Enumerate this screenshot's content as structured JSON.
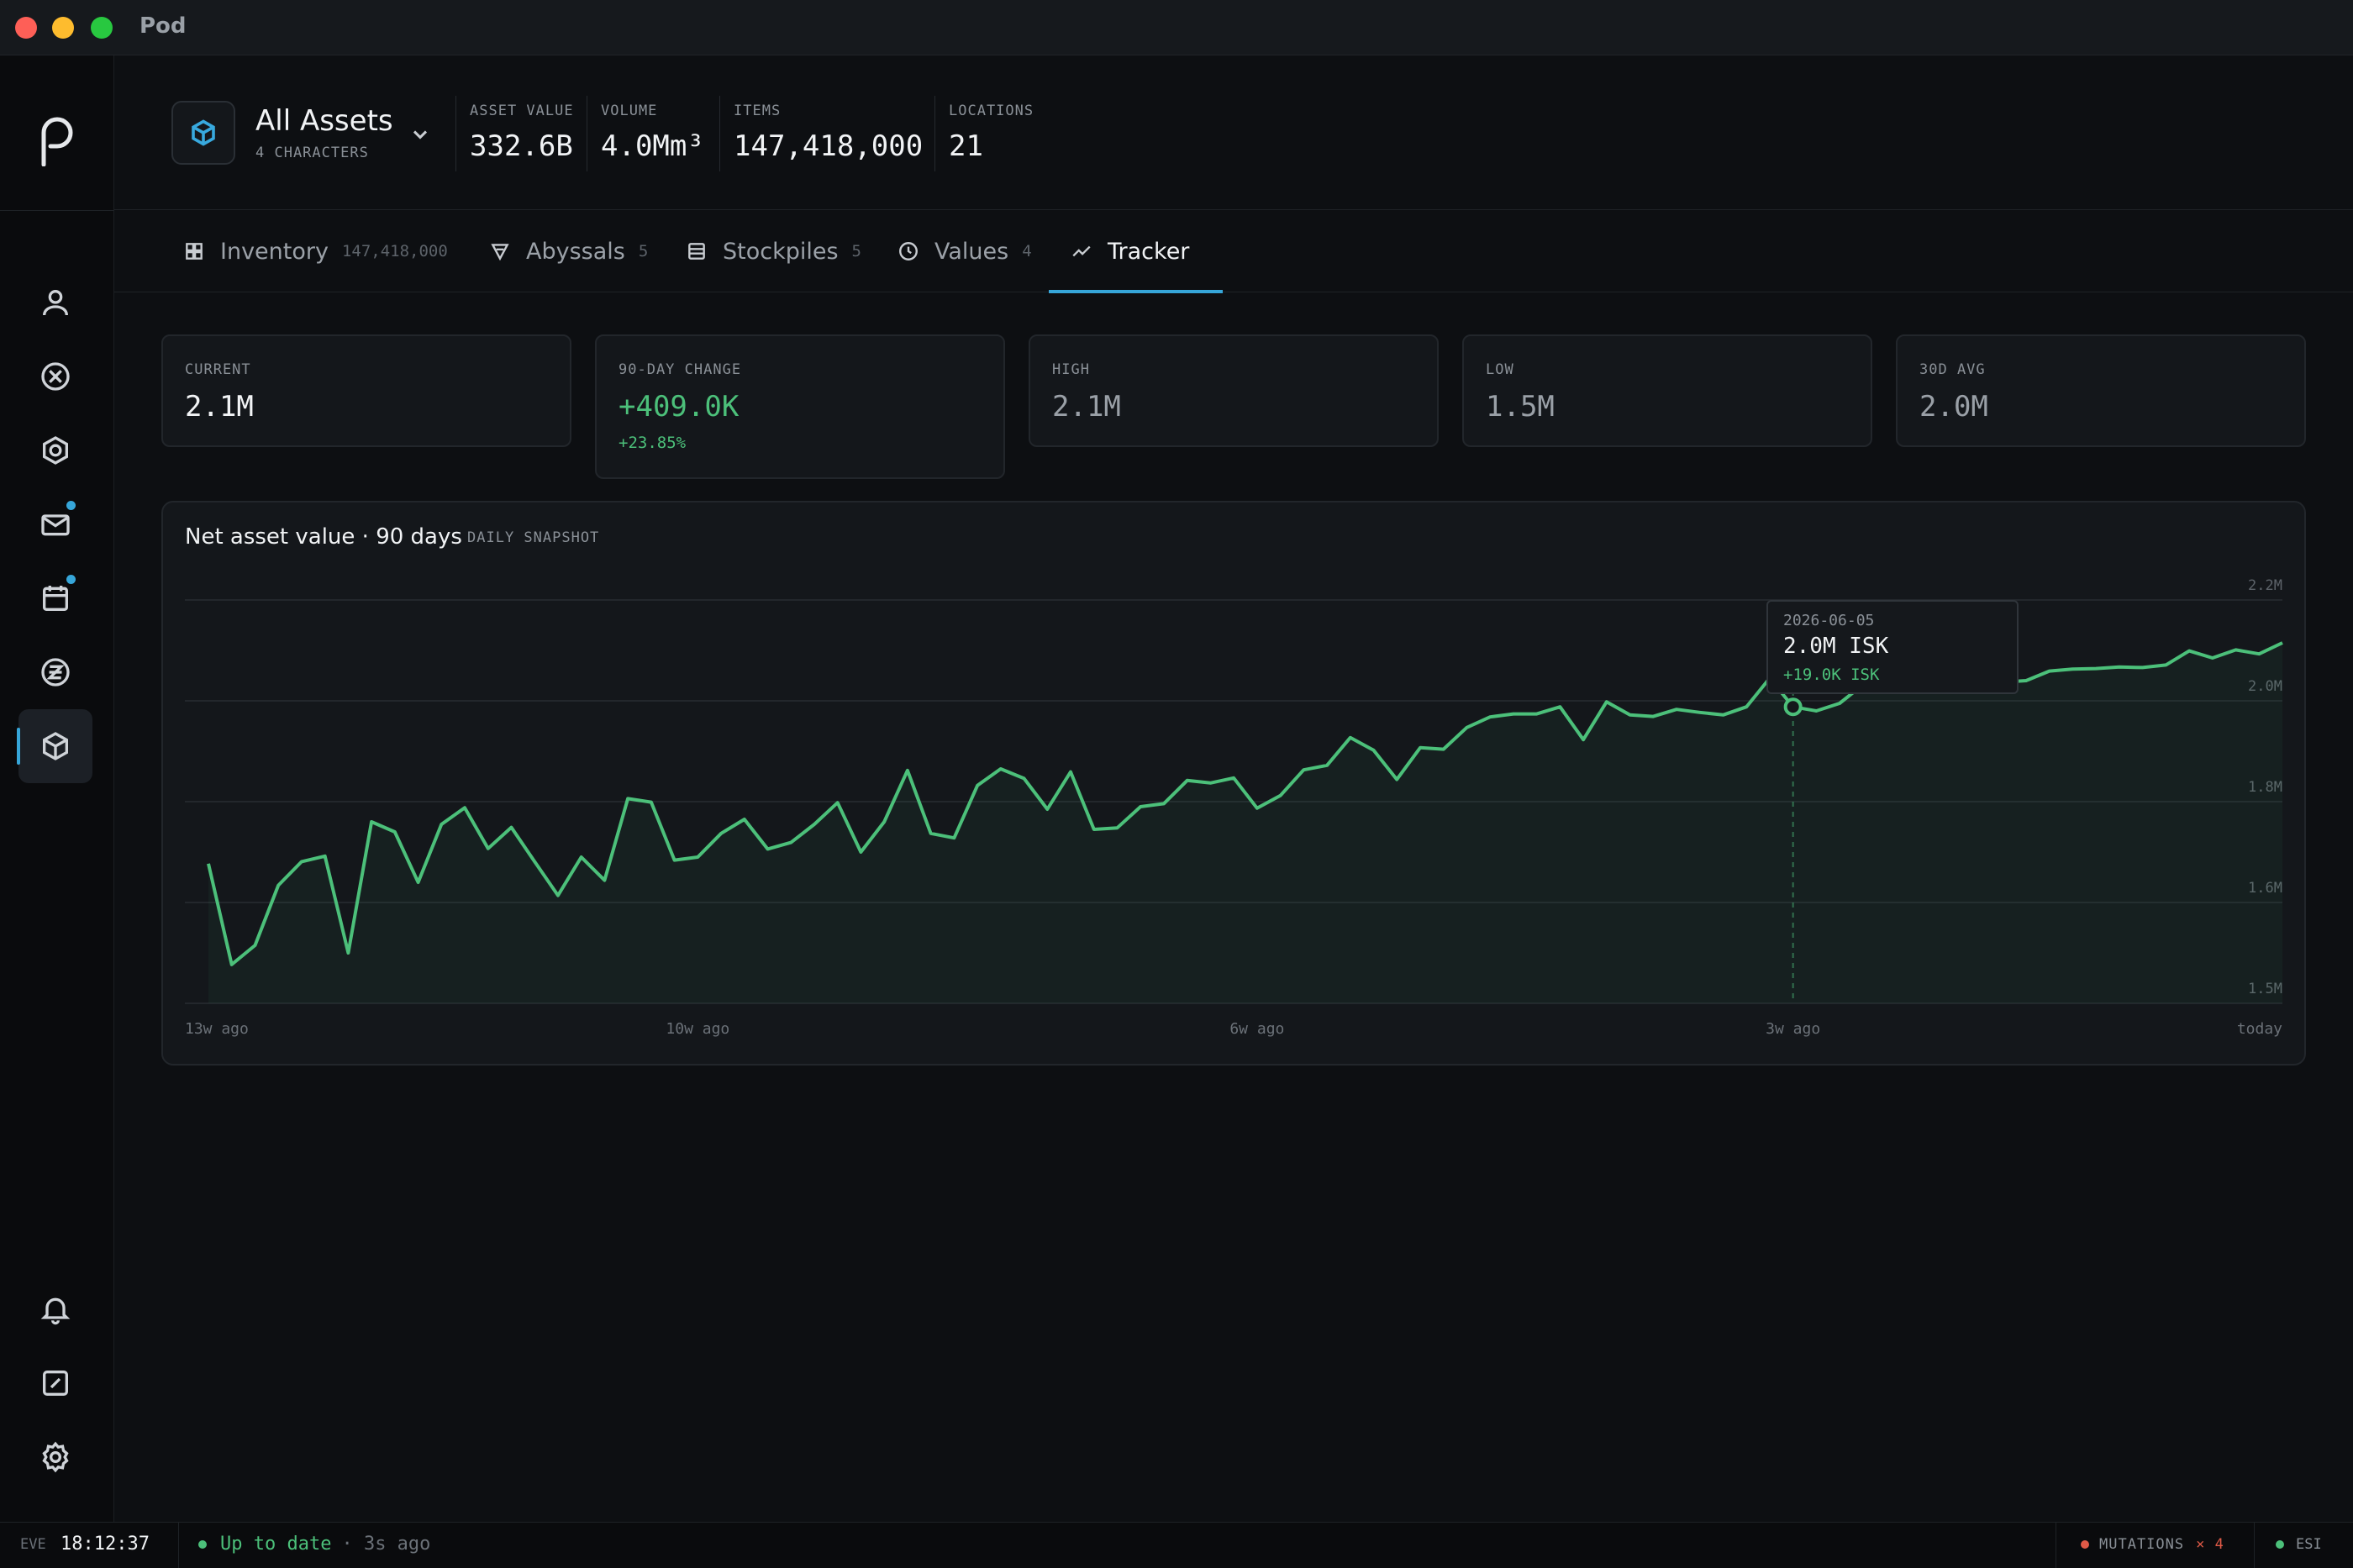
{
  "window": {
    "title": "Pod"
  },
  "header": {
    "title": "All Assets",
    "subtitle": "4 CHARACTERS",
    "stats": [
      {
        "label": "ASSET VALUE",
        "value": "332.6B"
      },
      {
        "label": "VOLUME",
        "value": "4.0Mm³"
      },
      {
        "label": "ITEMS",
        "value": "147,418,000"
      },
      {
        "label": "LOCATIONS",
        "value": "21"
      }
    ]
  },
  "tabs": [
    {
      "label": "Inventory",
      "count": "147,418,000",
      "icon": "grid-icon"
    },
    {
      "label": "Abyssals",
      "count": "5",
      "icon": "triangle-filter-icon"
    },
    {
      "label": "Stockpiles",
      "count": "5",
      "icon": "stack-icon"
    },
    {
      "label": "Values",
      "count": "4",
      "icon": "clock-icon"
    },
    {
      "label": "Tracker",
      "count": "",
      "icon": "trend-icon",
      "active": true
    }
  ],
  "cards": [
    {
      "label": "CURRENT",
      "value": "2.1M"
    },
    {
      "label": "90-DAY CHANGE",
      "value": "+409.0K",
      "sub": "+23.85%"
    },
    {
      "label": "HIGH",
      "value": "2.1M"
    },
    {
      "label": "LOW",
      "value": "1.5M"
    },
    {
      "label": "30D AVG",
      "value": "2.0M"
    }
  ],
  "panel": {
    "title": "Net asset value · 90 days",
    "badge": "DAILY SNAPSHOT"
  },
  "tooltip": {
    "date": "2026-06-05",
    "value": "2.0M ISK",
    "delta": "+19.0K ISK"
  },
  "statusbar": {
    "eve_label": "EVE",
    "time": "18:12:37",
    "sync_text": "Up to date",
    "sync_ago": "· 3s ago",
    "mutations_label": "MUTATIONS",
    "mutations_count": "× 4",
    "esi_label": "ESI"
  },
  "colors": {
    "accent": "#36a6d9",
    "positive": "#4cc07a",
    "negative": "#e05a47",
    "background": "#0d0f12"
  },
  "chart_data": {
    "type": "area",
    "title": "Net asset value · 90 days",
    "xlabel": "",
    "ylabel": "",
    "y_ticks": [
      {
        "label": "2.2M",
        "value": 2.2
      },
      {
        "label": "2.0M",
        "value": 2.0
      },
      {
        "label": "1.8M",
        "value": 1.8
      },
      {
        "label": "1.6M",
        "value": 1.6
      },
      {
        "label": "1.5M",
        "value": 1.4
      }
    ],
    "ylim": [
      1.4,
      2.2
    ],
    "x_ticks": [
      {
        "label": "13w ago",
        "index": 0
      },
      {
        "label": "10w ago",
        "index": 21
      },
      {
        "label": "6w ago",
        "index": 45
      },
      {
        "label": "3w ago",
        "index": 68
      },
      {
        "label": "today",
        "index": 90
      }
    ],
    "values": [
      1.677,
      1.477,
      1.515,
      1.634,
      1.681,
      1.692,
      1.5,
      1.76,
      1.74,
      1.64,
      1.755,
      1.788,
      1.707,
      1.749,
      1.681,
      1.614,
      1.69,
      1.644,
      1.806,
      1.799,
      1.684,
      1.69,
      1.737,
      1.765,
      1.706,
      1.719,
      1.755,
      1.798,
      1.7,
      1.76,
      1.862,
      1.737,
      1.728,
      1.832,
      1.865,
      1.846,
      1.785,
      1.859,
      1.745,
      1.748,
      1.79,
      1.796,
      1.842,
      1.837,
      1.847,
      1.787,
      1.812,
      1.863,
      1.872,
      1.927,
      1.902,
      1.844,
      1.907,
      1.904,
      1.947,
      1.968,
      1.974,
      1.974,
      1.988,
      1.923,
      1.998,
      1.972,
      1.969,
      1.983,
      1.977,
      1.972,
      1.988,
      2.045,
      1.988,
      1.98,
      1.995,
      2.032,
      2.036,
      2.044,
      2.041,
      2.033,
      2.039,
      2.037,
      2.04,
      2.059,
      2.063,
      2.064,
      2.067,
      2.066,
      2.071,
      2.099,
      2.085,
      2.101,
      2.093,
      2.115
    ],
    "highlight_index": 68,
    "grid": true,
    "line_color": "#4cc07a"
  }
}
